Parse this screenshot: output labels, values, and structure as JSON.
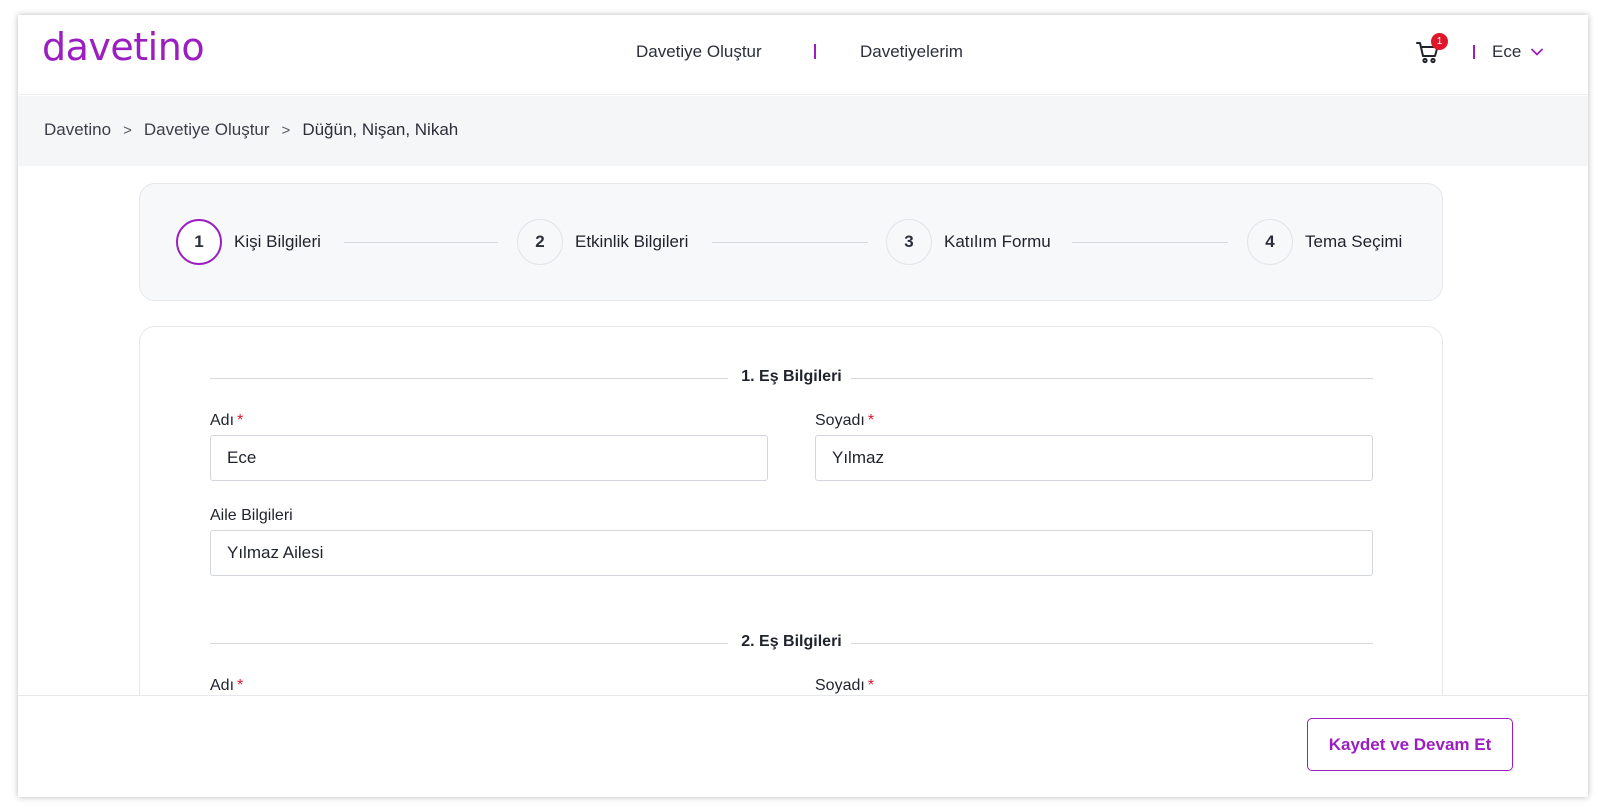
{
  "brand": {
    "logo": "davetino",
    "accent": "#9b1fc0"
  },
  "nav": {
    "items": [
      {
        "label": "Davetiye Oluştur"
      },
      {
        "label": "Davetiyelerim"
      }
    ]
  },
  "cart": {
    "count": "1",
    "icon": "cart-icon"
  },
  "user": {
    "name": "Ece",
    "icon": "chevron-down-icon"
  },
  "breadcrumb": {
    "items": [
      "Davetino",
      "Davetiye Oluştur"
    ],
    "current": "Düğün, Nişan, Nikah",
    "separator": ">"
  },
  "stepper": {
    "steps": [
      {
        "number": "1",
        "label": "Kişi Bilgileri",
        "active": true
      },
      {
        "number": "2",
        "label": "Etkinlik Bilgileri",
        "active": false
      },
      {
        "number": "3",
        "label": "Katılım Formu",
        "active": false
      },
      {
        "number": "4",
        "label": "Tema Seçimi",
        "active": false
      }
    ]
  },
  "form": {
    "required_mark": "*",
    "spouse1": {
      "title": "1. Eş Bilgileri",
      "first_name_label": "Adı",
      "first_name_value": "Ece",
      "last_name_label": "Soyadı",
      "last_name_value": "Yılmaz",
      "family_label": "Aile Bilgileri",
      "family_value": "Yılmaz Ailesi"
    },
    "spouse2": {
      "title": "2. Eş Bilgileri",
      "first_name_label": "Adı",
      "last_name_label": "Soyadı"
    }
  },
  "footer": {
    "save_label": "Kaydet ve Devam Et"
  }
}
